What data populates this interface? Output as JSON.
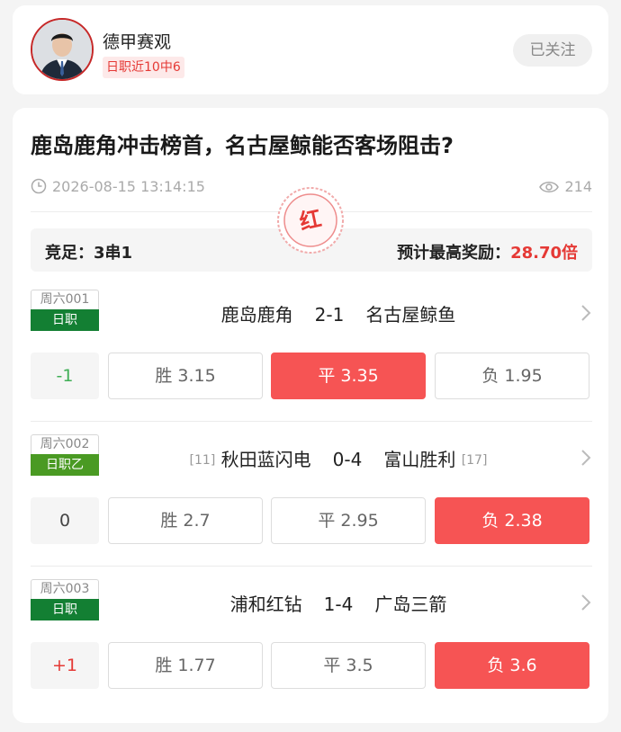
{
  "author": {
    "name": "德甲赛观",
    "badge": "日职近10中6",
    "follow_label": "已关注"
  },
  "article": {
    "title": "鹿岛鹿角冲击榜首，名古屋鲸能否客场阻击?",
    "time": "2026-08-15 13:14:15",
    "views": "214",
    "stamp_text": "红"
  },
  "summary": {
    "play_type": "竞足：3串1",
    "prize_label": "预计最高奖励：",
    "prize_value": "28.70倍"
  },
  "colors": {
    "accent_red": "#f65454",
    "league_green": "#137f33",
    "league_green_light": "#4a9a23",
    "handicap_green": "#3fae55",
    "handicap_red": "#e53935"
  },
  "matches": [
    {
      "day": "周六001",
      "league": "日职",
      "league_color": "#137f33",
      "home_rank": "",
      "home": "鹿岛鹿角",
      "score": "2-1",
      "away": "名古屋鲸鱼",
      "away_rank": "",
      "handicap": "-1",
      "handicap_color": "#3fae55",
      "odds": [
        {
          "label": "胜 3.15",
          "selected": false
        },
        {
          "label": "平 3.35",
          "selected": true
        },
        {
          "label": "负 1.95",
          "selected": false
        }
      ]
    },
    {
      "day": "周六002",
      "league": "日职乙",
      "league_color": "#4a9a23",
      "home_rank": "[11]",
      "home": "秋田蓝闪电",
      "score": "0-4",
      "away": "富山胜利",
      "away_rank": "[17]",
      "handicap": "0",
      "handicap_color": "#444444",
      "odds": [
        {
          "label": "胜 2.7",
          "selected": false
        },
        {
          "label": "平 2.95",
          "selected": false
        },
        {
          "label": "负 2.38",
          "selected": true
        }
      ]
    },
    {
      "day": "周六003",
      "league": "日职",
      "league_color": "#137f33",
      "home_rank": "",
      "home": "浦和红钻",
      "score": "1-4",
      "away": "广岛三箭",
      "away_rank": "",
      "handicap": "+1",
      "handicap_color": "#e53935",
      "odds": [
        {
          "label": "胜 1.77",
          "selected": false
        },
        {
          "label": "平 3.5",
          "selected": false
        },
        {
          "label": "负 3.6",
          "selected": true
        }
      ]
    }
  ]
}
